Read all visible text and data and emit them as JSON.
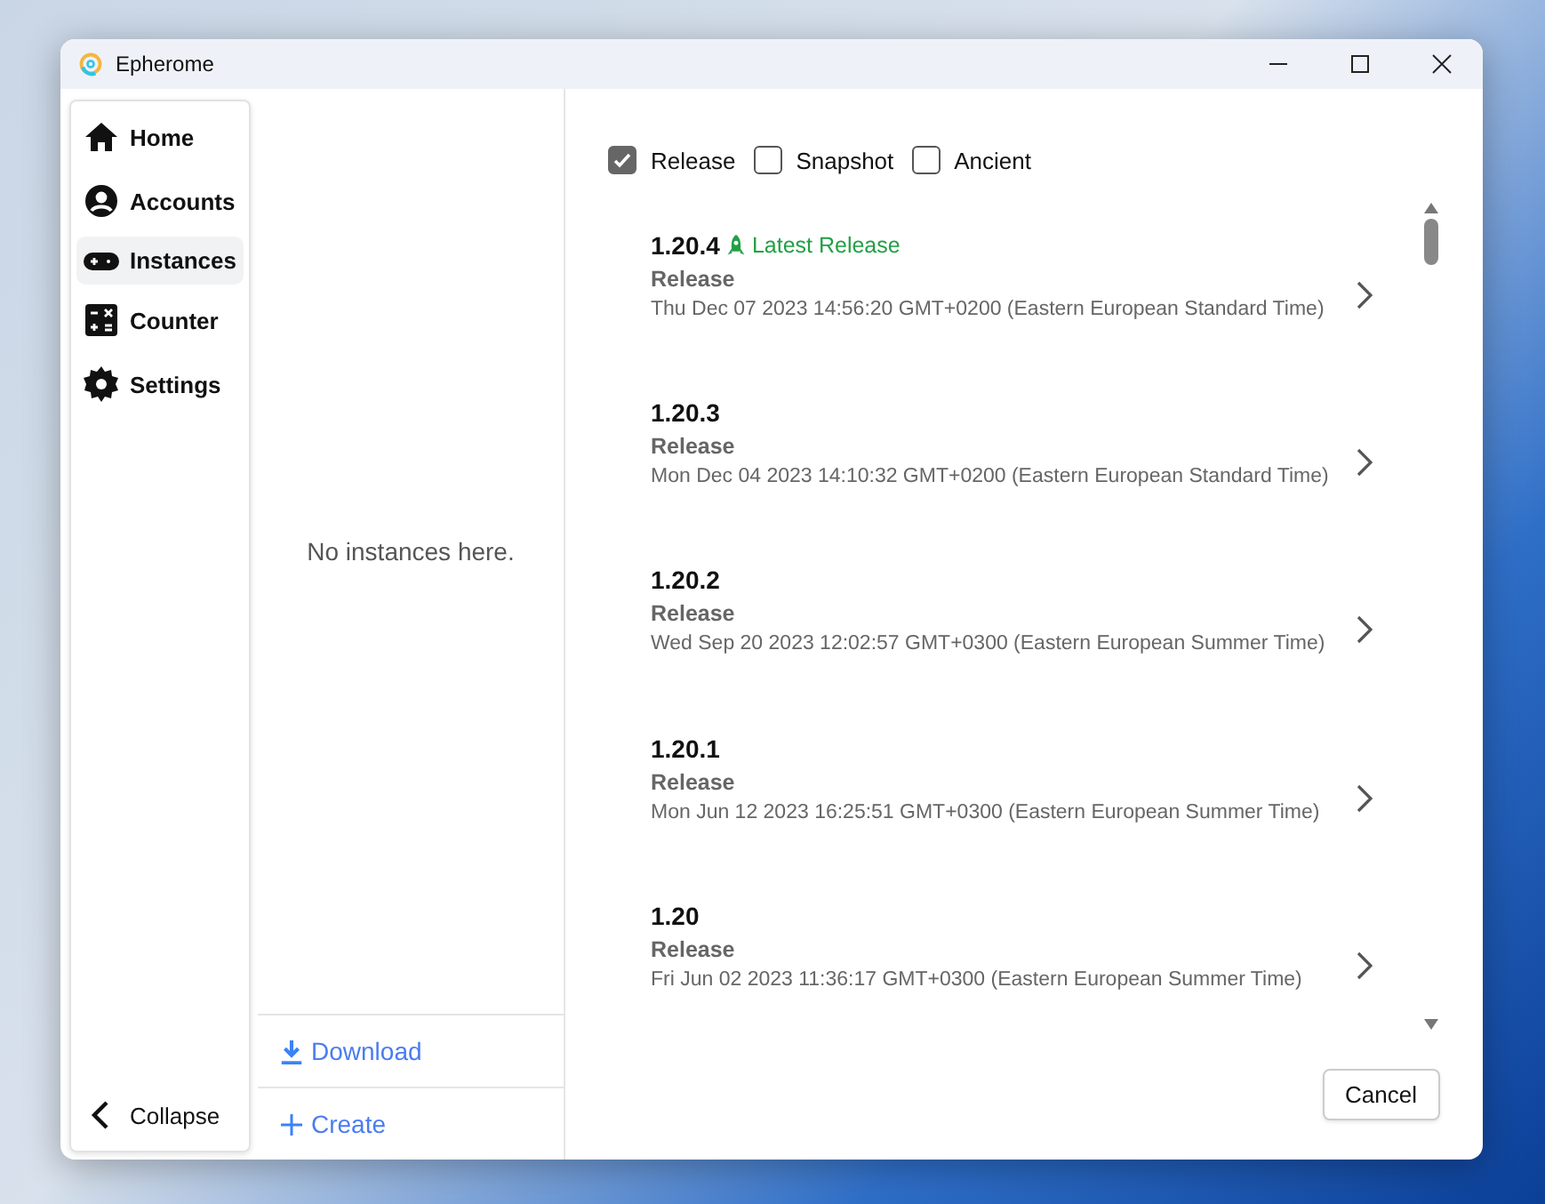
{
  "window": {
    "title": "Epherome"
  },
  "sidebar": {
    "items": [
      {
        "label": "Home",
        "kind": "home",
        "selected": false
      },
      {
        "label": "Accounts",
        "kind": "account",
        "selected": false
      },
      {
        "label": "Instances",
        "kind": "gamepad",
        "selected": true
      },
      {
        "label": "Counter",
        "kind": "calculator",
        "selected": false
      },
      {
        "label": "Settings",
        "kind": "gear",
        "selected": false
      }
    ],
    "collapse": "Collapse"
  },
  "instances": {
    "empty_text": "No instances here.",
    "actions": [
      {
        "label": "Download",
        "kind": "download"
      },
      {
        "label": "Create",
        "kind": "create"
      }
    ]
  },
  "filters": [
    {
      "label": "Release",
      "checked": true
    },
    {
      "label": "Snapshot",
      "checked": false
    },
    {
      "label": "Ancient",
      "checked": false
    }
  ],
  "versions": [
    {
      "version": "1.20.4",
      "badge": "Latest Release",
      "type": "Release",
      "date": "Thu Dec 07 2023 14:56:20 GMT+0200 (Eastern European Standard Time)"
    },
    {
      "version": "1.20.3",
      "type": "Release",
      "date": "Mon Dec 04 2023 14:10:32 GMT+0200 (Eastern European Standard Time)"
    },
    {
      "version": "1.20.2",
      "type": "Release",
      "date": "Wed Sep 20 2023 12:02:57 GMT+0300 (Eastern European Summer Time)"
    },
    {
      "version": "1.20.1",
      "type": "Release",
      "date": "Mon Jun 12 2023 16:25:51 GMT+0300 (Eastern European Summer Time)"
    },
    {
      "version": "1.20",
      "type": "Release",
      "date": "Fri Jun 02 2023 11:36:17 GMT+0300 (Eastern European Summer Time)"
    }
  ],
  "cancel_button": "Cancel"
}
